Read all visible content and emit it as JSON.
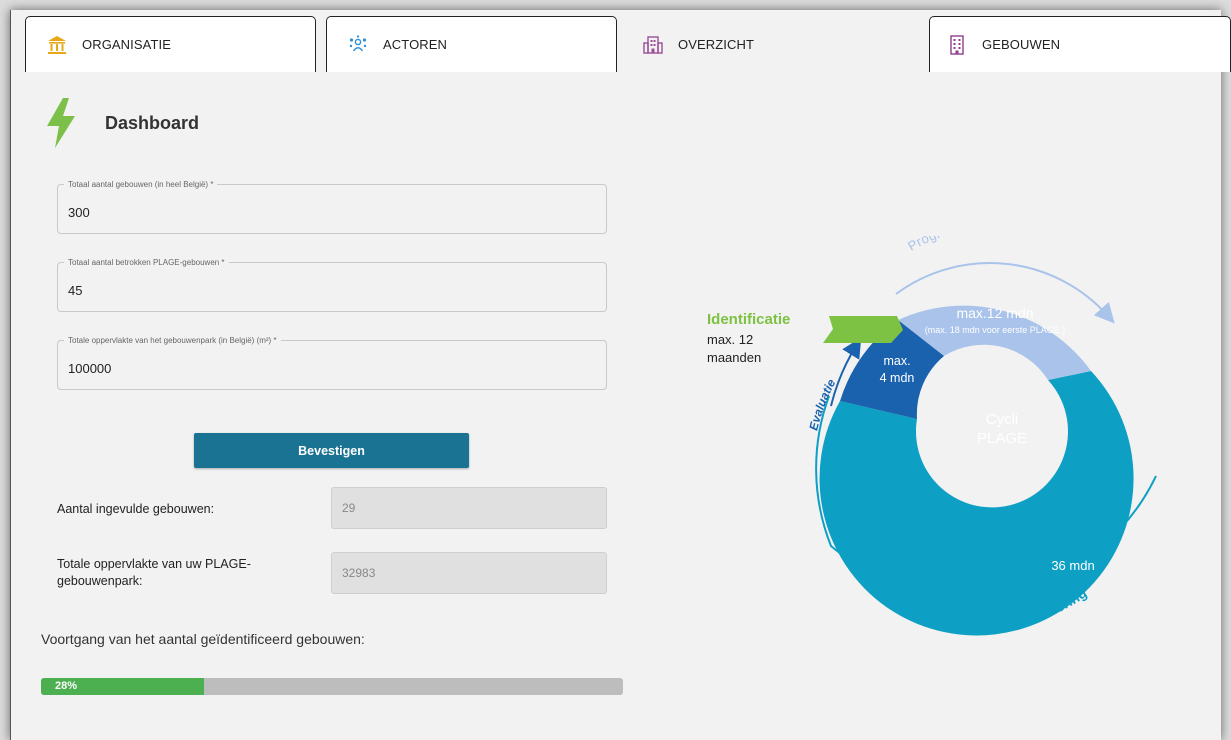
{
  "tabs": [
    {
      "label": "ORGANISATIE",
      "icon": "bank-icon",
      "active": false
    },
    {
      "label": "ACTOREN",
      "icon": "people-icon",
      "active": false
    },
    {
      "label": "OVERZICHT",
      "icon": "buildings-icon",
      "active": true
    },
    {
      "label": "GEBOUWEN",
      "icon": "building-icon",
      "active": false
    }
  ],
  "dashboard": {
    "title": "Dashboard",
    "icon": "lightning-bolt-icon"
  },
  "form": {
    "fields": [
      {
        "label": "Totaal aantal gebouwen (in heel België) *",
        "value": "300"
      },
      {
        "label": "Totaal aantal betrokken PLAGE-gebouwen *",
        "value": "45"
      },
      {
        "label": "Totale oppervlakte van het gebouwenpark (in België) (m²) *",
        "value": "100000"
      }
    ],
    "confirm_label": "Bevestigen"
  },
  "stats": {
    "filled_label": "Aantal ingevulde gebouwen:",
    "filled_value": "29",
    "area_label_line1": "Totale oppervlakte van uw PLAGE-",
    "area_label_line2": "gebouwenpark:",
    "area_value": "32983"
  },
  "progress": {
    "title": "Voortgang van het aantal geïdentificeerd gebouwen:",
    "percent": 28,
    "label": "28%"
  },
  "diagram": {
    "center_line1": "Cycli",
    "center_line2": "PLAGE",
    "programmering": "Programmering",
    "prog_duration": "max.12 mdn",
    "prog_note": "(max. 18 mdn voor eerste PLAGE )",
    "eval_line1": "max.",
    "eval_line2": "4 mdn",
    "uitvoering_duration": "36 mdn",
    "identificatie": "Identificatie",
    "ident_line1": "max. 12",
    "ident_line2": "maanden",
    "evaluatie": "Evaluatie",
    "uitvoering": "Uitvoering",
    "colors": {
      "uitvoering": "#0d9fc4",
      "programmering": "#a9c3ea",
      "evaluatie": "#1a62ad",
      "identificatie": "#7dc242",
      "arrow_text": "#1a62ad"
    }
  }
}
